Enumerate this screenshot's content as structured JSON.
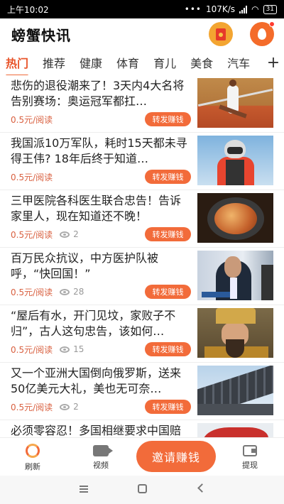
{
  "status_bar": {
    "time": "上午10:02",
    "speed": "107K/s",
    "battery": "31"
  },
  "header": {
    "title": "螃蟹快讯"
  },
  "tabs": [
    "热门",
    "推荐",
    "健康",
    "体育",
    "育儿",
    "美食",
    "汽车"
  ],
  "tab_more": "+",
  "feed": [
    {
      "title": "悲伤的退役潮来了！3天内4大名将告别赛场：奥运冠军都扛…",
      "price": "0.5元/阅读",
      "views": "",
      "share_label": "转发赚钱"
    },
    {
      "title": "我国派10万军队，耗时15天都未寻得王伟? 18年后终于知道…",
      "price": "0.5元/阅读",
      "views": "",
      "share_label": "转发赚钱"
    },
    {
      "title": "三甲医院各科医生联合忠告！告诉家里人，现在知道还不晚！",
      "price": "0.5元/阅读",
      "views": "2",
      "share_label": "转发赚钱"
    },
    {
      "title": "百万民众抗议，中方医护队被呼，“快回国！”",
      "price": "0.5元/阅读",
      "views": "28",
      "share_label": "转发赚钱"
    },
    {
      "title": "“屋后有水，开门见坟，家败子不归”，古人这句忠告，该如何…",
      "price": "0.5元/阅读",
      "views": "15",
      "share_label": "转发赚钱"
    },
    {
      "title": "又一个亚洲大国倒向俄罗斯，送来50亿美元大礼，美也无可奈…",
      "price": "0.5元/阅读",
      "views": "2",
      "share_label": "转发赚钱"
    },
    {
      "title": "必须零容忍！多国相继要求中国赔偿疫情损失 美兴风作浪是",
      "price": "",
      "views": "",
      "share_label": ""
    }
  ],
  "bottom_nav": {
    "refresh": "刷新",
    "video": "视频",
    "invite": "邀请赚钱",
    "withdraw": "提现"
  },
  "colors": {
    "accent": "#f26b3a",
    "active_tab": "#e8542a",
    "price": "#d96040"
  }
}
